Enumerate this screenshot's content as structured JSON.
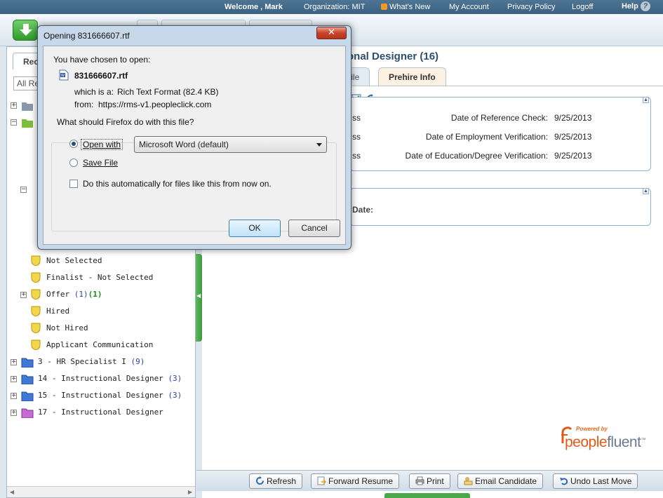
{
  "topbar": {
    "welcome": "Welcome , Mark",
    "organization": "Organization: MIT",
    "whats_new": "What's New",
    "my_account": "My Account",
    "privacy_policy": "Privacy Policy",
    "logoff": "Logoff",
    "help": "Help"
  },
  "left": {
    "tab_label": "Rec",
    "filter_value": "All Re",
    "tree": [
      {
        "label": "Not Selected"
      },
      {
        "label": "Finalist - Not Selected"
      },
      {
        "label": "Offer ",
        "count": "(1)",
        "count2": "(1)"
      },
      {
        "label": "Hired"
      },
      {
        "label": "Not Hired"
      },
      {
        "label": "Applicant Communication"
      },
      {
        "label": "3 - HR Specialist I ",
        "count": "(9)"
      },
      {
        "label": "14 - Instructional Designer ",
        "count": "(3)"
      },
      {
        "label": "15 - Instructional Designer ",
        "count": "(3)"
      },
      {
        "label": "17 - Instructional Designer"
      }
    ]
  },
  "main": {
    "title": "onal Designer (16)",
    "tab_profile": "file",
    "tab_prehire": "Prehire Info",
    "rows": [
      {
        "left": "ss",
        "label": "Date of Reference Check:",
        "value": "9/25/2013"
      },
      {
        "left": "ss",
        "label": "Date of Employment Verification:",
        "value": "9/25/2013"
      },
      {
        "left": "ss",
        "label": "Date of Education/Degree Verification:",
        "value": "9/25/2013"
      }
    ],
    "panel2_label": "Date:"
  },
  "logo": {
    "powered_by": "Powered by",
    "brand_a": "people",
    "brand_b": "fluent",
    "tm": "™"
  },
  "toolbar": {
    "refresh": "Refresh",
    "forward_resume": "Forward Resume",
    "print": "Print",
    "email_candidate": "Email Candidate",
    "undo_last_move": "Undo Last Move"
  },
  "dialog": {
    "title": "Opening 831666607.rtf",
    "chosen": "You have chosen to open:",
    "filename": "831666607.rtf",
    "which_is_label": "which is a:",
    "which_is_value": "Rich Text Format (82.4 KB)",
    "from_label": "from:",
    "from_value": "https://rms-v1.peopleclick.com",
    "question": "What should Firefox do with this file?",
    "open_with": "Open with",
    "app": "Microsoft Word (default)",
    "save_file": "Save File",
    "auto": "Do this automatically for files like this from now on.",
    "ok": "OK",
    "cancel": "Cancel"
  },
  "colors": {
    "accent_green": "#49a94a",
    "title_blue": "#2e4f6c",
    "brand_orange": "#e05a1a"
  }
}
